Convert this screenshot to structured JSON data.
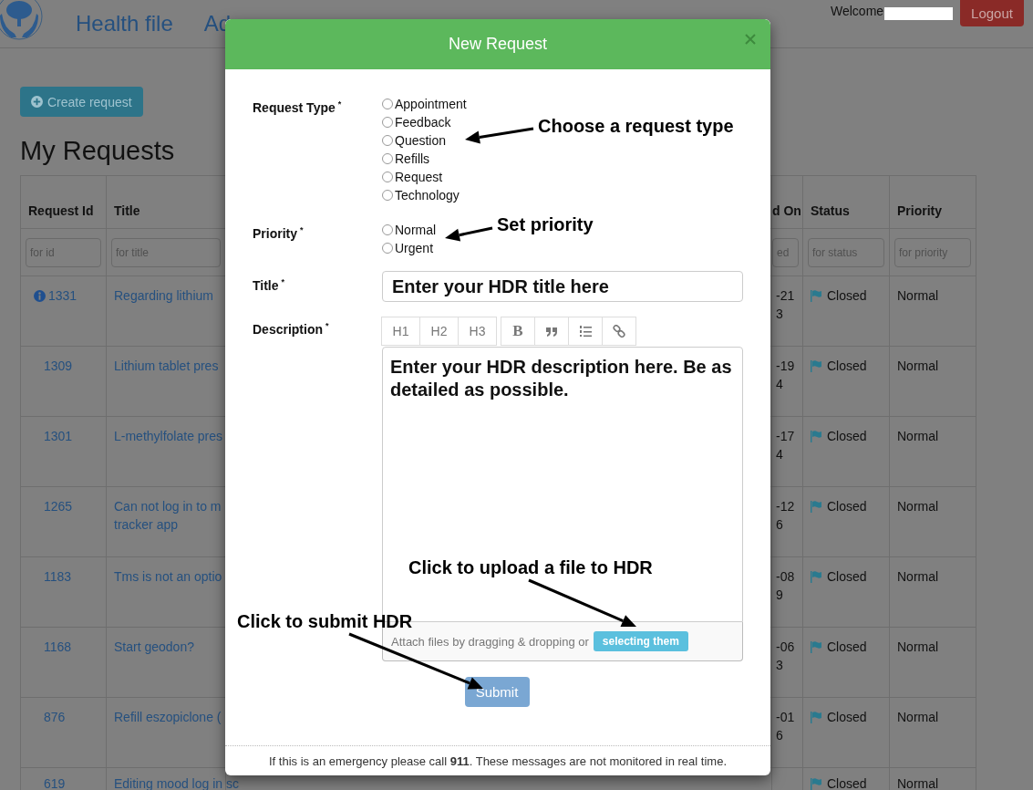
{
  "nav": {
    "items": [
      {
        "label": "Health file"
      },
      {
        "label": "Ad"
      }
    ],
    "welcome": "Welcome",
    "logout": "Logout"
  },
  "create_button": "Create request",
  "heading": "My Requests",
  "table": {
    "columns": [
      {
        "label": "Request Id",
        "placeholder": "for id"
      },
      {
        "label": "Title",
        "placeholder": "for title"
      },
      {
        "label": "d On",
        "placeholder": "ed"
      },
      {
        "label": "Status",
        "placeholder": "for status"
      },
      {
        "label": "Priority",
        "placeholder": "for priority"
      }
    ],
    "rows": [
      {
        "id": "1331",
        "info": true,
        "title": [
          "Regarding lithium"
        ],
        "date": [
          "-21",
          "3"
        ],
        "status": "Closed",
        "priority": "Normal"
      },
      {
        "id": "1309",
        "info": false,
        "title": [
          "Lithium tablet pres"
        ],
        "date": [
          "-19",
          "4"
        ],
        "status": "Closed",
        "priority": "Normal"
      },
      {
        "id": "1301",
        "info": false,
        "title": [
          "L-methylfolate pres"
        ],
        "date": [
          "-17",
          "4"
        ],
        "status": "Closed",
        "priority": "Normal"
      },
      {
        "id": "1265",
        "info": false,
        "title": [
          "Can not log in to m",
          "tracker app"
        ],
        "date": [
          "-12",
          "6"
        ],
        "status": "Closed",
        "priority": "Normal"
      },
      {
        "id": "1183",
        "info": false,
        "title": [
          "Tms is not an optio"
        ],
        "date": [
          "-08",
          "9"
        ],
        "status": "Closed",
        "priority": "Normal"
      },
      {
        "id": "1168",
        "info": false,
        "title": [
          "Start geodon?"
        ],
        "date": [
          "-06",
          "3"
        ],
        "status": "Closed",
        "priority": "Normal"
      },
      {
        "id": "876",
        "info": false,
        "title": [
          "Refill eszopiclone ("
        ],
        "date": [
          "-01",
          "6"
        ],
        "status": "Closed",
        "priority": "Normal"
      },
      {
        "id": "619",
        "info": false,
        "title": [
          "Editing mood log in sc"
        ],
        "status": "Closed",
        "priority": "Normal"
      }
    ]
  },
  "modal": {
    "title": "New Request",
    "fields": [
      {
        "kind": "radio",
        "label": "Request Type",
        "mark": "*",
        "options": [
          {
            "label": "Appointment",
            "selected": false
          },
          {
            "label": "Feedback",
            "selected": false
          },
          {
            "label": "Question",
            "selected": false
          },
          {
            "label": "Refills",
            "selected": false
          },
          {
            "label": "Request",
            "selected": false
          },
          {
            "label": "Technology",
            "selected": false
          }
        ]
      },
      {
        "kind": "radio",
        "label": "Priority",
        "mark": "*",
        "options": [
          {
            "label": "Normal",
            "selected": false
          },
          {
            "label": "Urgent",
            "selected": false
          }
        ]
      },
      {
        "kind": "text",
        "label": "Title",
        "mark": "*",
        "value": "Enter your HDR title here"
      },
      {
        "kind": "editor",
        "label": "Description",
        "mark": "*",
        "toolbar": [
          [
            {
              "kind": "text",
              "label": "H1"
            },
            {
              "kind": "text",
              "label": "H2"
            },
            {
              "kind": "text",
              "label": "H3"
            }
          ],
          [
            {
              "kind": "glyph",
              "label": "B"
            },
            {
              "kind": "quote"
            },
            {
              "kind": "ordered-list"
            },
            {
              "kind": "link"
            }
          ]
        ],
        "value": "Enter your HDR description here. Be as detailed as possible.",
        "attach_text": "Attach files by dragging & dropping or",
        "attach_button": "selecting them"
      }
    ],
    "submit": "Submit",
    "footer": "If this is an emergency please call **911**. These messages are not monitored in real time.",
    "annotations": [
      {
        "text": "Choose a request type"
      },
      {
        "text": "Set priority"
      },
      {
        "text": "Click to upload a file to HDR"
      },
      {
        "text": "Click to submit HDR"
      }
    ]
  }
}
